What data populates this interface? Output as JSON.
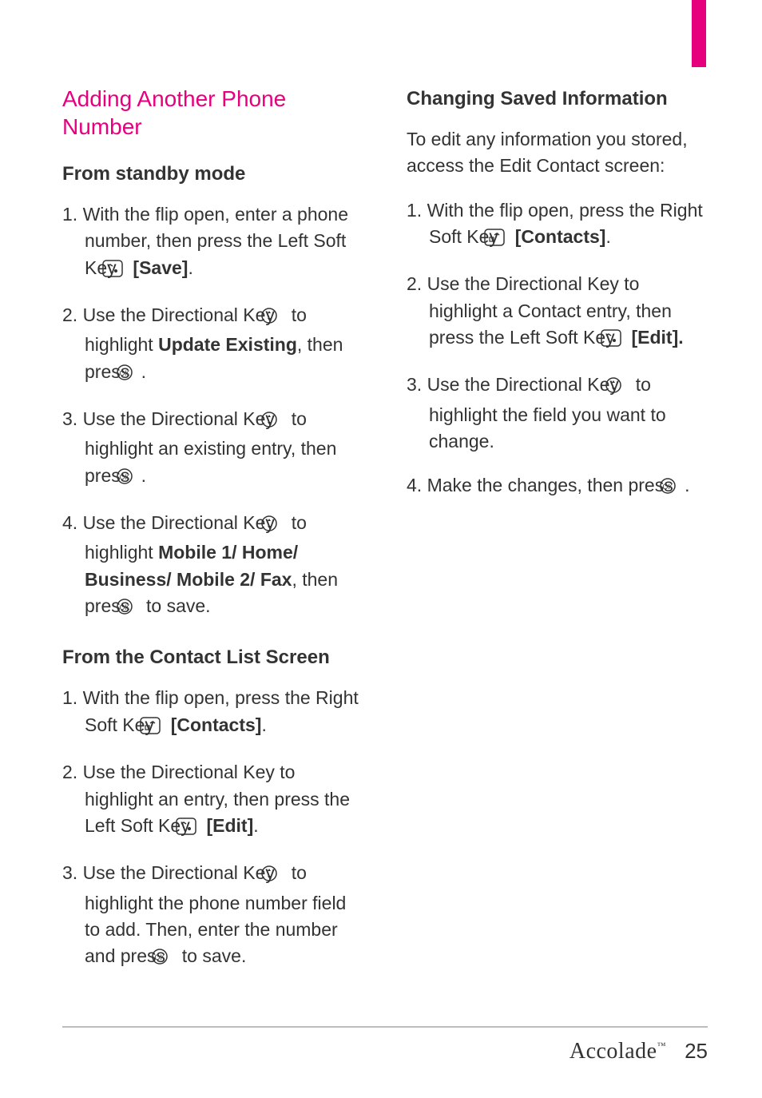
{
  "left": {
    "title": "Adding Another Phone Number",
    "sub1": "From standby mode",
    "s1a_pre": "1. With the flip open, enter a phone number, then press the Left Soft Key ",
    "s1a_bold": "[Save]",
    "s1a_post": ".",
    "s2a_pre": "2. Use the Directional Key ",
    "s2a_mid": " to highlight ",
    "s2a_bold": "Update Existing",
    "s2a_post": ", then press ",
    "s2a_end": ".",
    "s3a_pre": "3. Use the Directional Key ",
    "s3a_mid": " to highlight an existing entry, then press ",
    "s3a_end": ".",
    "s4a_pre": "4. Use the Directional Key ",
    "s4a_mid": " to highlight ",
    "s4a_bold": "Mobile 1/ Home/ Business/ Mobile 2/ Fax",
    "s4a_post": ", then press ",
    "s4a_end": " to save.",
    "sub2": "From the Contact List Screen",
    "s1b_pre": "1. With the flip open, press the Right Soft Key ",
    "s1b_bold": "[Contacts]",
    "s1b_post": ".",
    "s2b_pre": "2. Use the Directional Key  to highlight an entry, then press the Left Soft Key ",
    "s2b_bold": "[Edit]",
    "s2b_post": ".",
    "s3b_pre": "3. Use the Directional Key ",
    "s3b_mid": " to highlight the phone number field to add. Then, enter the number and press ",
    "s3b_end": " to save."
  },
  "right": {
    "title": "Changing Saved Information",
    "intro": "To edit any information you stored, access the Edit Contact screen:",
    "s1_pre": "1. With the flip open, press the Right Soft Key ",
    "s1_bold": "[Contacts]",
    "s1_post": ".",
    "s2_pre": "2. Use the Directional Key  to highlight a Contact entry, then press the Left Soft Key ",
    "s2_bold": "[Edit].",
    "s3_pre": "3. Use the Directional Key ",
    "s3_mid": " to highlight the field you want to change.",
    "s4_pre": "4. Make the changes, then press ",
    "s4_end": "."
  },
  "footer": {
    "brand": "Accolade",
    "tm": "™",
    "page": "25"
  }
}
